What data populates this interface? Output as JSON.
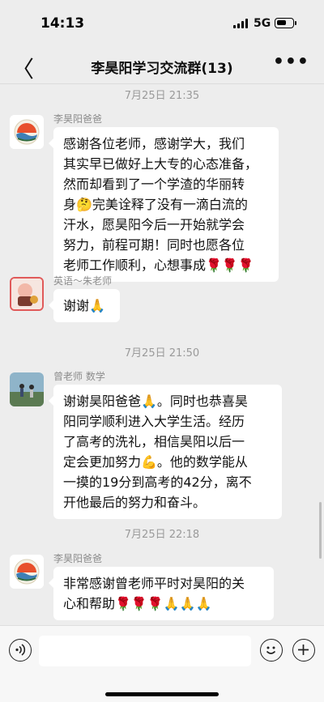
{
  "status": {
    "time": "14:13",
    "network": "5G"
  },
  "header": {
    "back_glyph": "〈",
    "title": "李昊阳学习交流群(13)",
    "more_glyph": "•••"
  },
  "messages": [
    {
      "timestamp": "7月25日 21:35",
      "sender": "李昊阳爸爸",
      "lines": [
        "感谢各位老师，感谢学大，我们",
        "其实早已做好上大专的心态准备，",
        "然而却看到了一个学渣的华丽转",
        "身🤔完美诠释了没有一滴白流的",
        "汗水，愿昊阳今后一开始就学会",
        "努力，前程可期！同时也愿各位",
        "老师工作顺利，心想事成🌹🌹🌹"
      ]
    },
    {
      "sender": "英语～朱老师",
      "lines": [
        "谢谢🙏"
      ]
    },
    {
      "timestamp": "7月25日 21:50",
      "sender": "曾老师 数学",
      "lines": [
        "谢谢昊阳爸爸🙏。同时也恭喜昊",
        "阳同学顺利进入大学生活。经历",
        "了高考的洗礼，相信昊阳以后一",
        "定会更加努力💪。他的数学能从",
        "一摸的19分到高考的42分，离不",
        "开他最后的努力和奋斗。"
      ]
    },
    {
      "timestamp": "7月25日 22:18",
      "sender": "李昊阳爸爸",
      "lines": [
        "非常感谢曾老师平时对昊阳的关",
        "心和帮助🌹🌹🌹🙏🙏🙏"
      ]
    }
  ],
  "colors": {
    "background": "#ededed",
    "bubble": "#ffffff",
    "meta_text": "#9a9a9a"
  },
  "icons": [
    "back-arrow-icon",
    "more-icon",
    "voice-icon",
    "emoji-icon",
    "plus-icon"
  ]
}
